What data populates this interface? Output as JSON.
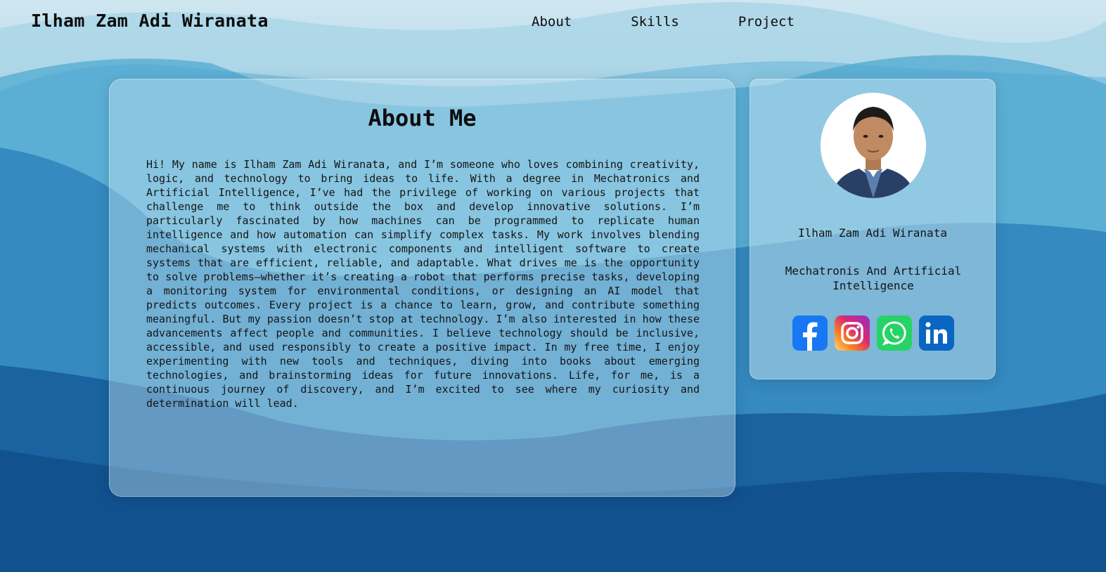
{
  "header": {
    "brand": "Ilham Zam Adi Wiranata",
    "nav": [
      "About",
      "Skills",
      "Project"
    ]
  },
  "about": {
    "title": "About Me",
    "text": "Hi! My name is Ilham Zam Adi Wiranata, and I’m someone who loves combining creativity, logic, and technology to bring ideas to life. With a degree in Mechatronics and Artificial Intelligence, I’ve had the privilege of working on various projects that challenge me to think outside the box and develop innovative solutions. I’m particularly fascinated by how machines can be programmed to replicate human intelligence and how automation can simplify complex tasks. My work involves blending mechanical systems with electronic components and intelligent software to create systems that are efficient, reliable, and adaptable. What drives me is the opportunity to solve problems—whether it’s creating a robot that performs precise tasks, developing a monitoring system for environmental conditions, or designing an AI model that predicts outcomes. Every project is a chance to learn, grow, and contribute something meaningful. But my passion doesn’t stop at technology. I’m also interested in how these advancements affect people and communities. I believe technology should be inclusive, accessible, and used responsibly to create a positive impact. In my free time, I enjoy experimenting with new tools and techniques, diving into books about emerging technologies, and brainstorming ideas for future innovations. Life, for me, is a continuous journey of discovery, and I’m excited to see where my curiosity and determination will lead."
  },
  "profile": {
    "name": "Ilham Zam Adi Wiranata",
    "role": "Mechatronis And Artificial Intelligence",
    "socials": [
      {
        "icon": "facebook-icon",
        "color": "#1877F2"
      },
      {
        "icon": "instagram-icon",
        "color": "#E1306C"
      },
      {
        "icon": "whatsapp-icon",
        "color": "#25D366"
      },
      {
        "icon": "linkedin-icon",
        "color": "#0A66C2"
      }
    ]
  }
}
